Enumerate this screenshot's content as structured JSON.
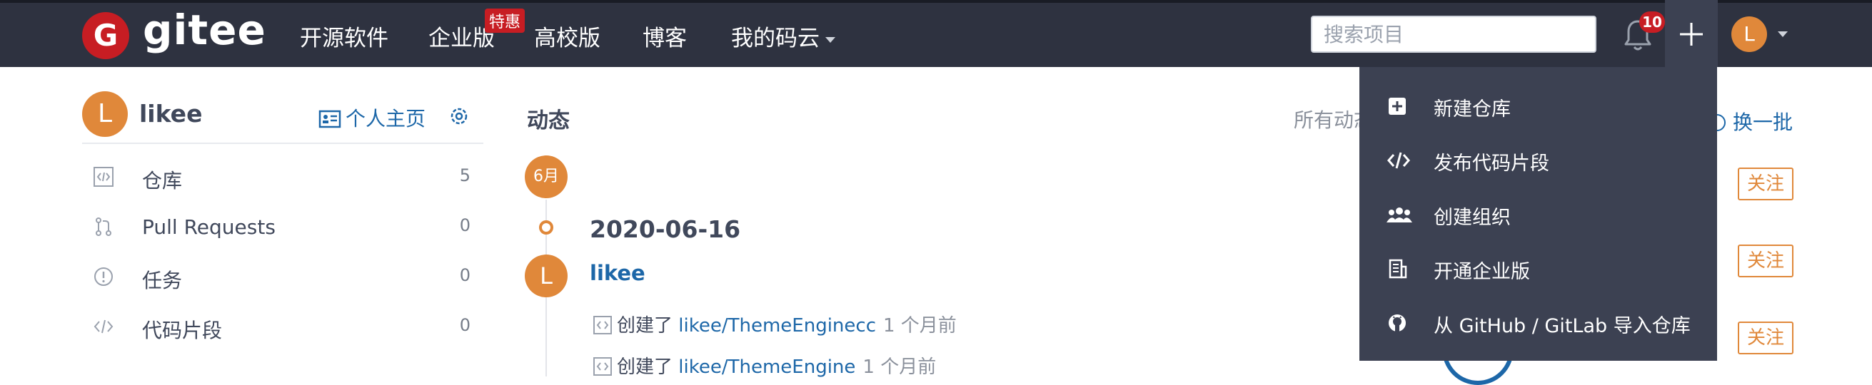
{
  "nav": {
    "logo_letter": "G",
    "logo_text": "gitee",
    "items": [
      "开源软件",
      "企业版",
      "高校版",
      "博客"
    ],
    "hot_badge": "特惠",
    "my_gitee": "我的码云",
    "search_placeholder": "搜索项目",
    "notification_count": "10",
    "avatar_letter": "L"
  },
  "sidebar": {
    "avatar_letter": "L",
    "username": "likee",
    "homepage_label": "个人主页",
    "items": [
      {
        "label": "仓库",
        "count": "5"
      },
      {
        "label": "Pull Requests",
        "count": "0"
      },
      {
        "label": "任务",
        "count": "0"
      },
      {
        "label": "代码片段",
        "count": "0"
      }
    ]
  },
  "feed": {
    "title": "动态",
    "all_feed_label": "所有动态",
    "month": "6月",
    "date": "2020-06-16",
    "avatar_letter": "L",
    "user": "likee",
    "activities": [
      {
        "verb": "创建了",
        "repo": "likee/ThemeEnginecc",
        "time": "1 个月前"
      },
      {
        "verb": "创建了",
        "repo": "likee/ThemeEngine",
        "time": "1 个月前"
      }
    ]
  },
  "recommend": {
    "swap_label": "换一批",
    "follow_label": "关注"
  },
  "dropdown": {
    "items": [
      {
        "label": "新建仓库",
        "icon": "plus-square-icon"
      },
      {
        "label": "发布代码片段",
        "icon": "code-icon"
      },
      {
        "label": "创建组织",
        "icon": "users-icon"
      },
      {
        "label": "开通企业版",
        "icon": "building-icon"
      },
      {
        "label": "从 GitHub / GitLab 导入仓库",
        "icon": "github-icon"
      }
    ]
  },
  "colors": {
    "nav_bg": "#2e3240",
    "dropdown_bg": "#3c4152",
    "accent_orange": "#e0883a",
    "link_blue": "#1d67a8",
    "brand_red": "#c71d23"
  }
}
